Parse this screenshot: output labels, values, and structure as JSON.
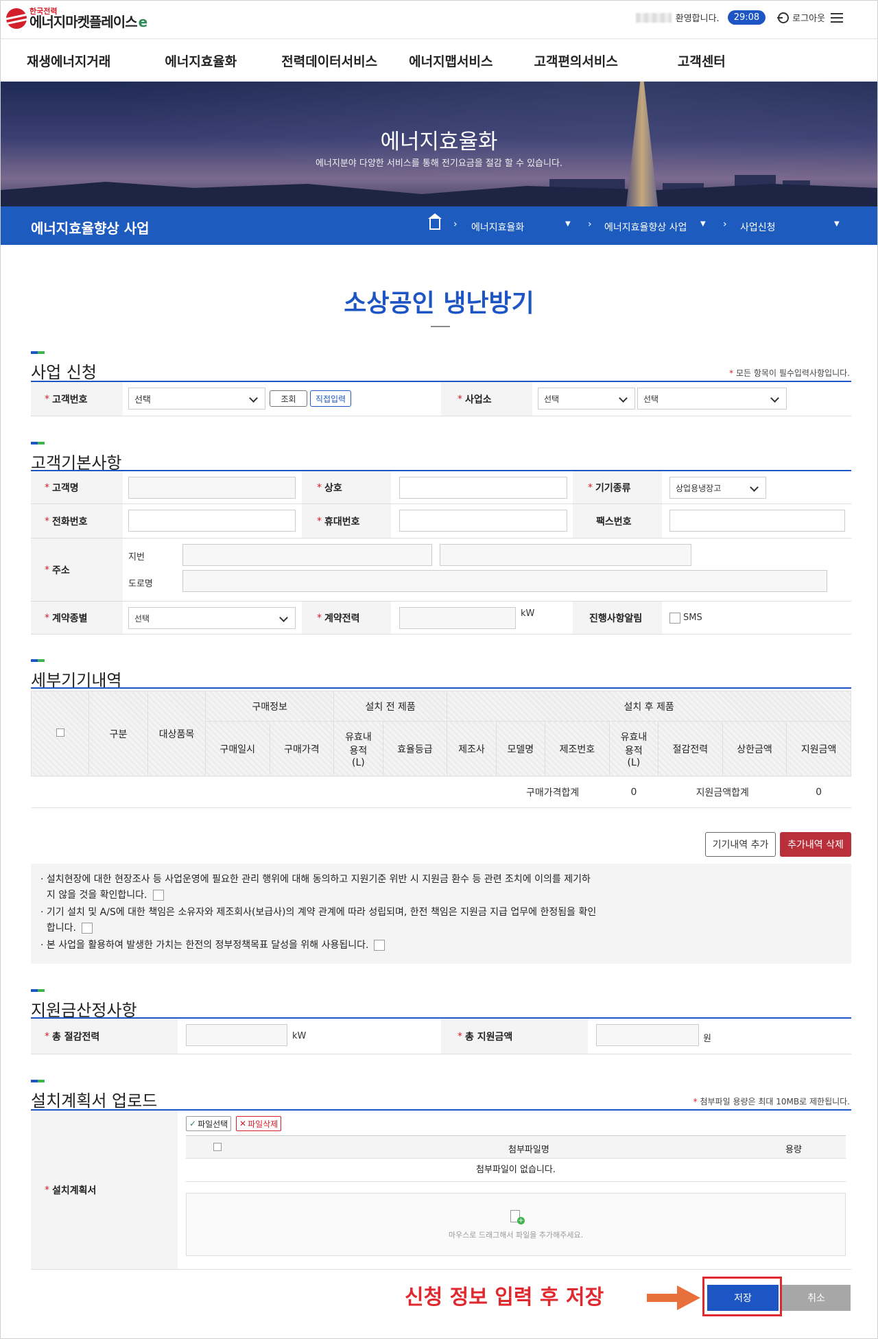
{
  "header": {
    "logo_kepco": "한국전력",
    "logo_name": "에너지마켓플레이스",
    "logo_leaf": "e",
    "welcome": "환영합니다.",
    "timer": "29:08",
    "logout": "로그아웃"
  },
  "gnb": [
    "재생에너지거래",
    "에너지효율화",
    "전력데이터서비스",
    "에너지맵서비스",
    "고객편의서비스",
    "고객센터"
  ],
  "hero": {
    "title": "에너지효율화",
    "subtitle": "에너지분야 다양한 서비스를 통해 전기요금을 절감 할 수 있습니다."
  },
  "subnav": {
    "title": "에너지효율향상 사업",
    "crumbs": [
      "에너지효율화",
      "에너지효율향상 사업",
      "사업신청"
    ]
  },
  "page_title": "소상공인 냉난방기",
  "apply": {
    "title": "사업 신청",
    "note": "모든 항목이 필수입력사항입니다.",
    "customer_no_label": "고객번호",
    "customer_no_value": "선택",
    "query_btn": "조회",
    "direct_btn": "직접입력",
    "site_label": "사업소",
    "site_value1": "선택",
    "site_value2": "선택"
  },
  "basic": {
    "title": "고객기본사항",
    "name_label": "고객명",
    "company_label": "상호",
    "device_type_label": "기기종류",
    "device_type_value": "상업용냉장고",
    "phone_label": "전화번호",
    "mobile_label": "휴대번호",
    "fax_label": "팩스번호",
    "address_label": "주소",
    "addr_lot_label": "지번",
    "addr_road_label": "도로명",
    "contract_type_label": "계약종별",
    "contract_type_value": "선택",
    "contract_power_label": "계약전력",
    "contract_power_unit": "kW",
    "progress_label": "진행사항알림",
    "sms_label": "SMS"
  },
  "detail": {
    "title": "세부기기내역",
    "h_category": "구분",
    "h_target": "대상품목",
    "h_purchase": "구매정보",
    "h_before": "설치 전 제품",
    "h_after": "설치 후 제품",
    "h_buy_date": "구매일시",
    "h_buy_price": "구매가격",
    "h_capacity_line1": "유효내",
    "h_capacity_line2": "용적",
    "h_capacity_line3": "(L)",
    "h_grade": "효율등급",
    "h_maker": "제조사",
    "h_model": "모델명",
    "h_serial": "제조번호",
    "h_saving": "절감전력",
    "h_limit": "상한금액",
    "h_support": "지원금액",
    "sum_price_label": "구매가격합계",
    "sum_price_value": "0",
    "sum_support_label": "지원금액합계",
    "sum_support_value": "0",
    "add_btn": "기기내역 추가",
    "delete_btn": "추가내역 삭제"
  },
  "consent": {
    "line1a": "설치현장에 대한 현장조사 등 사업운영에 필요한 관리 행위에 대해 동의하고 지원기준 위반 시 지원금 환수 등 관련 조치에 이의를 제기하",
    "line1b": "지 않을 것을 확인합니다.",
    "line2a": "기기 설치 및 A/S에 대한 책임은 소유자와 제조회사(보급사)의 계약 관계에 따라 성립되며, 한전 책임은 지원금 지급 업무에 한정됨을 확인",
    "line2b": "합니다.",
    "line3": "본 사업을 활용하여 발생한 가치는 한전의 정부정책목표 달성을 위해 사용됩니다."
  },
  "support": {
    "title": "지원금산정사항",
    "total_saving_label": "총 절감전력",
    "total_saving_unit": "kW",
    "total_support_label": "총 지원금액",
    "total_support_unit": "원"
  },
  "upload": {
    "title": "설치계획서 업로드",
    "note": "첨부파일 용량은 최대 10MB로 제한됩니다.",
    "label": "설치계획서",
    "select_btn": "파일선택",
    "delete_btn": "파일삭제",
    "col_name": "첨부파일명",
    "col_size": "용량",
    "empty": "첨부파일이 없습니다.",
    "drop_hint": "마우스로 드래그해서 파일을 추가해주세요."
  },
  "footer": {
    "annotation": "신청 정보 입력 후 저장",
    "save": "저장",
    "cancel": "취소"
  },
  "colors": {
    "primary": "#1d56c4",
    "accent_red": "#e0292f",
    "danger_btn": "#b9303a"
  }
}
